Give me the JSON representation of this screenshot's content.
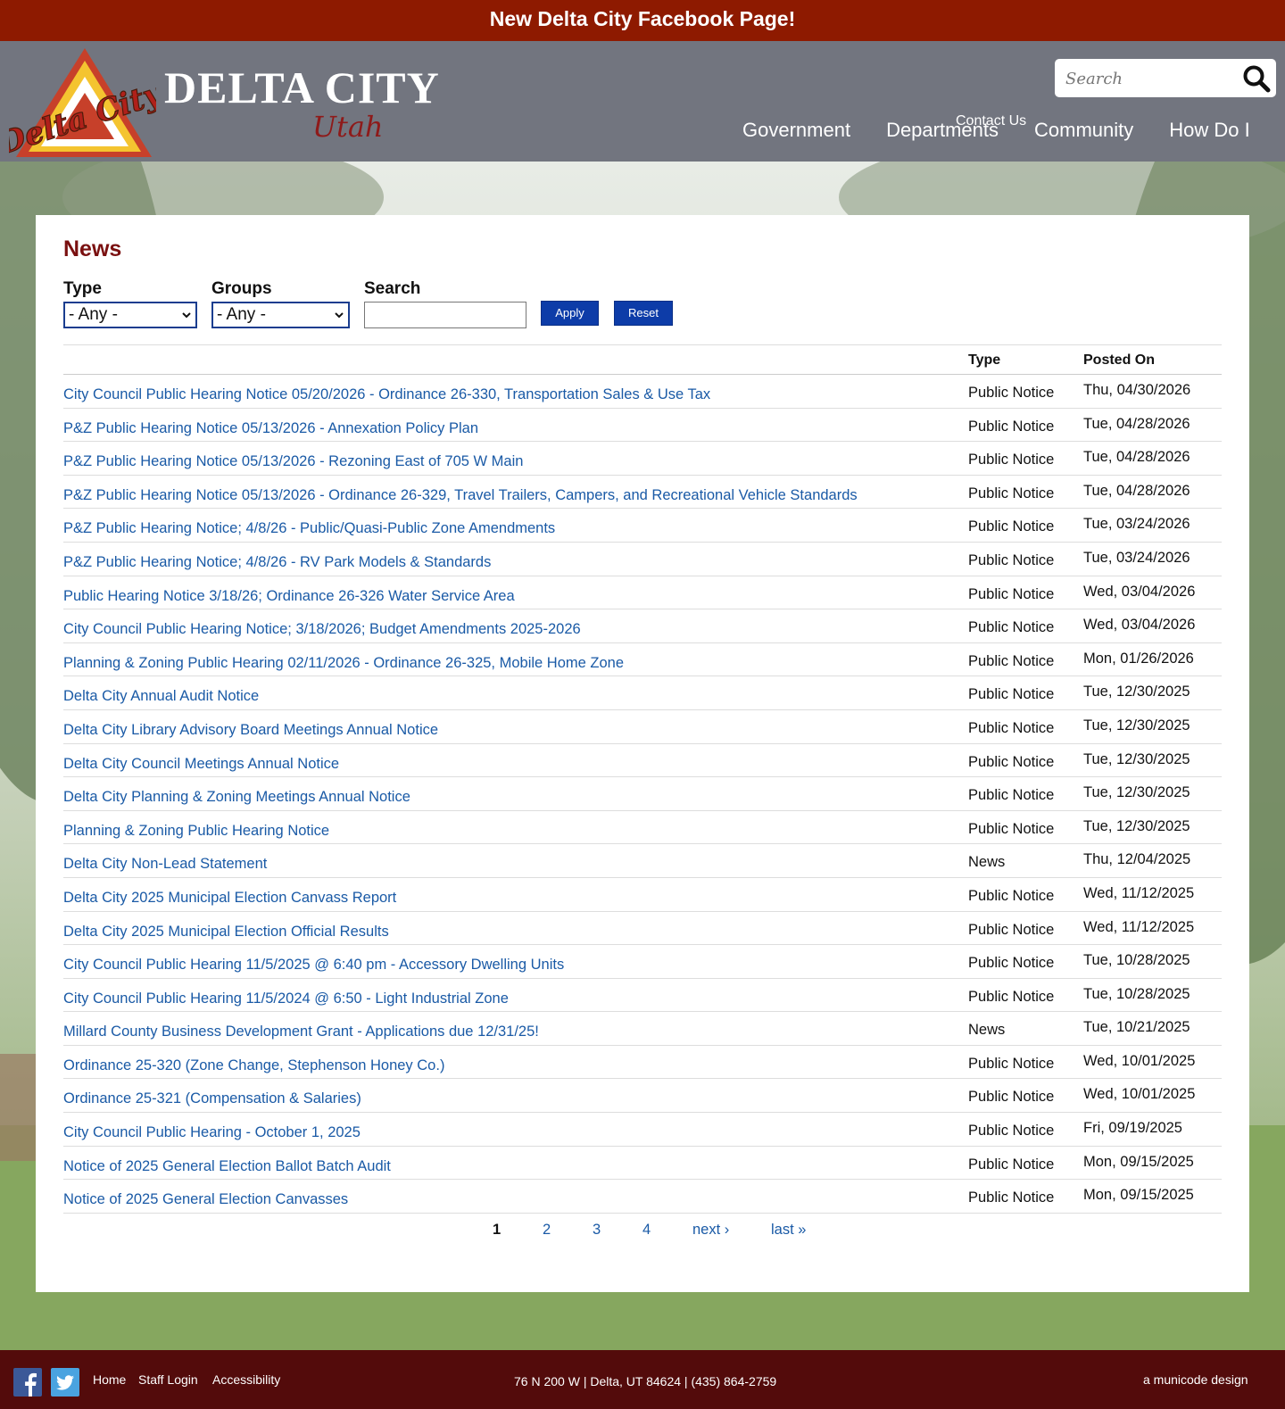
{
  "banner": {
    "text": "New Delta City Facebook Page!"
  },
  "header": {
    "site_name": "DELTA CITY",
    "site_sub": "Utah",
    "logo_text": "Delta City",
    "contact_label": "Contact Us",
    "search_placeholder": "Search",
    "nav": [
      "Government",
      "Departments",
      "Community",
      "How Do I"
    ]
  },
  "colors": {
    "banner": "#8e1a00",
    "header": "#72757f",
    "title": "#7a1010",
    "link": "#1a5aa6",
    "button": "#0d3ca8",
    "footer": "#530b0b"
  },
  "page": {
    "title": "News",
    "filters": {
      "type_label": "Type",
      "type_value": "- Any -",
      "groups_label": "Groups",
      "groups_value": "- Any -",
      "search_label": "Search",
      "apply_label": "Apply",
      "reset_label": "Reset"
    },
    "table": {
      "col_type": "Type",
      "col_posted": "Posted On",
      "rows": [
        {
          "title": "City Council Public Hearing Notice 05/20/2026 - Ordinance 26-330, Transportation Sales & Use Tax",
          "type": "Public Notice",
          "date": "Thu, 04/30/2026"
        },
        {
          "title": "P&Z Public Hearing Notice 05/13/2026 - Annexation Policy Plan",
          "type": "Public Notice",
          "date": "Tue, 04/28/2026"
        },
        {
          "title": "P&Z Public Hearing Notice 05/13/2026 - Rezoning East of 705 W Main",
          "type": "Public Notice",
          "date": "Tue, 04/28/2026"
        },
        {
          "title": "P&Z Public Hearing Notice 05/13/2026 - Ordinance 26-329, Travel Trailers, Campers, and Recreational Vehicle Standards",
          "type": "Public Notice",
          "date": "Tue, 04/28/2026"
        },
        {
          "title": "P&Z Public Hearing Notice; 4/8/26 - Public/Quasi-Public Zone Amendments",
          "type": "Public Notice",
          "date": "Tue, 03/24/2026"
        },
        {
          "title": "P&Z Public Hearing Notice; 4/8/26 - RV Park Models & Standards",
          "type": "Public Notice",
          "date": "Tue, 03/24/2026"
        },
        {
          "title": "Public Hearing Notice 3/18/26; Ordinance 26-326 Water Service Area",
          "type": "Public Notice",
          "date": "Wed, 03/04/2026"
        },
        {
          "title": "City Council Public Hearing Notice; 3/18/2026; Budget Amendments 2025-2026",
          "type": "Public Notice",
          "date": "Wed, 03/04/2026"
        },
        {
          "title": "Planning & Zoning Public Hearing 02/11/2026 - Ordinance 26-325, Mobile Home Zone",
          "type": "Public Notice",
          "date": "Mon, 01/26/2026"
        },
        {
          "title": "Delta City Annual Audit Notice",
          "type": "Public Notice",
          "date": "Tue, 12/30/2025"
        },
        {
          "title": "Delta City Library Advisory Board Meetings Annual Notice",
          "type": "Public Notice",
          "date": "Tue, 12/30/2025"
        },
        {
          "title": "Delta City Council Meetings Annual Notice",
          "type": "Public Notice",
          "date": "Tue, 12/30/2025"
        },
        {
          "title": "Delta City Planning & Zoning Meetings Annual Notice",
          "type": "Public Notice",
          "date": "Tue, 12/30/2025"
        },
        {
          "title": "Planning & Zoning Public Hearing Notice",
          "type": "Public Notice",
          "date": "Tue, 12/30/2025"
        },
        {
          "title": "Delta City Non-Lead Statement",
          "type": "News",
          "date": "Thu, 12/04/2025"
        },
        {
          "title": "Delta City 2025 Municipal Election Canvass Report",
          "type": "Public Notice",
          "date": "Wed, 11/12/2025"
        },
        {
          "title": "Delta City 2025 Municipal Election Official Results",
          "type": "Public Notice",
          "date": "Wed, 11/12/2025"
        },
        {
          "title": "City Council Public Hearing 11/5/2025 @ 6:40 pm - Accessory Dwelling Units",
          "type": "Public Notice",
          "date": "Tue, 10/28/2025"
        },
        {
          "title": "City Council Public Hearing 11/5/2024 @ 6:50 - Light Industrial Zone",
          "type": "Public Notice",
          "date": "Tue, 10/28/2025"
        },
        {
          "title": "Millard County Business Development Grant - Applications due 12/31/25!",
          "type": "News",
          "date": "Tue, 10/21/2025"
        },
        {
          "title": "Ordinance 25-320 (Zone Change, Stephenson Honey Co.)",
          "type": "Public Notice",
          "date": "Wed, 10/01/2025"
        },
        {
          "title": "Ordinance 25-321 (Compensation & Salaries)",
          "type": "Public Notice",
          "date": "Wed, 10/01/2025"
        },
        {
          "title": "City Council Public Hearing - October 1, 2025",
          "type": "Public Notice",
          "date": "Fri, 09/19/2025"
        },
        {
          "title": "Notice of 2025 General Election Ballot Batch Audit",
          "type": "Public Notice",
          "date": "Mon, 09/15/2025"
        },
        {
          "title": "Notice of 2025 General Election Canvasses",
          "type": "Public Notice",
          "date": "Mon, 09/15/2025"
        }
      ]
    },
    "pager": {
      "current": "1",
      "pages": [
        "2",
        "3",
        "4"
      ],
      "next": "next ›",
      "last": "last »"
    }
  },
  "footer": {
    "links": [
      "Home",
      "Staff Login",
      "Accessibility"
    ],
    "address": "76 N 200 W | Delta, UT 84624 | (435) 864-2759",
    "credit": "a municode design",
    "social_icons": [
      "facebook-icon",
      "twitter-icon"
    ]
  }
}
